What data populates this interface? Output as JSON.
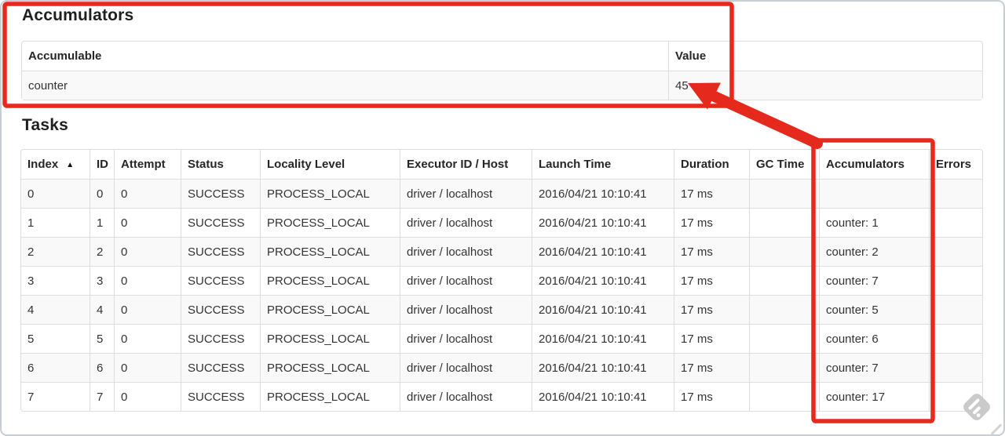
{
  "page": {
    "accumulators_section": {
      "title": "Accumulators",
      "columns": [
        "Accumulable",
        "Value"
      ],
      "rows": [
        [
          "counter",
          "45"
        ]
      ]
    },
    "tasks_section": {
      "title": "Tasks",
      "sort_indicator": "▲",
      "columns": [
        "Index",
        "ID",
        "Attempt",
        "Status",
        "Locality Level",
        "Executor ID / Host",
        "Launch Time",
        "Duration",
        "GC Time",
        "Accumulators",
        "Errors"
      ],
      "rows": [
        [
          "0",
          "0",
          "0",
          "SUCCESS",
          "PROCESS_LOCAL",
          "driver / localhost",
          "2016/04/21 10:10:41",
          "17 ms",
          "",
          "",
          ""
        ],
        [
          "1",
          "1",
          "0",
          "SUCCESS",
          "PROCESS_LOCAL",
          "driver / localhost",
          "2016/04/21 10:10:41",
          "17 ms",
          "",
          "counter: 1",
          ""
        ],
        [
          "2",
          "2",
          "0",
          "SUCCESS",
          "PROCESS_LOCAL",
          "driver / localhost",
          "2016/04/21 10:10:41",
          "17 ms",
          "",
          "counter: 2",
          ""
        ],
        [
          "3",
          "3",
          "0",
          "SUCCESS",
          "PROCESS_LOCAL",
          "driver / localhost",
          "2016/04/21 10:10:41",
          "17 ms",
          "",
          "counter: 7",
          ""
        ],
        [
          "4",
          "4",
          "0",
          "SUCCESS",
          "PROCESS_LOCAL",
          "driver / localhost",
          "2016/04/21 10:10:41",
          "17 ms",
          "",
          "counter: 5",
          ""
        ],
        [
          "5",
          "5",
          "0",
          "SUCCESS",
          "PROCESS_LOCAL",
          "driver / localhost",
          "2016/04/21 10:10:41",
          "17 ms",
          "",
          "counter: 6",
          ""
        ],
        [
          "6",
          "6",
          "0",
          "SUCCESS",
          "PROCESS_LOCAL",
          "driver / localhost",
          "2016/04/21 10:10:41",
          "17 ms",
          "",
          "counter: 7",
          ""
        ],
        [
          "7",
          "7",
          "0",
          "SUCCESS",
          "PROCESS_LOCAL",
          "driver / localhost",
          "2016/04/21 10:10:41",
          "17 ms",
          "",
          "counter: 17",
          ""
        ]
      ]
    },
    "annotations": {
      "color": "#e5291d"
    }
  }
}
